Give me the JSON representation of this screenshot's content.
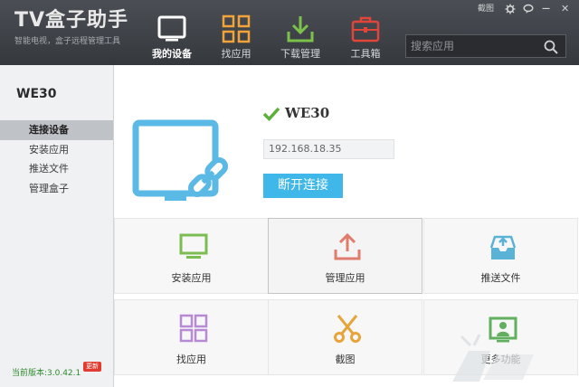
{
  "app": {
    "title": "TV盒子助手",
    "subtitle": "智能电视，盒子远程管理工具"
  },
  "nav": [
    {
      "label": "我的设备",
      "icon": "tv-icon",
      "active": true
    },
    {
      "label": "找应用",
      "icon": "grid-icon",
      "active": false
    },
    {
      "label": "下载管理",
      "icon": "download-icon",
      "active": false
    },
    {
      "label": "工具箱",
      "icon": "toolbox-icon",
      "active": false
    }
  ],
  "window_controls": {
    "screenshot": "截图",
    "settings_icon": "gear-icon",
    "feedback_icon": "chat-icon",
    "minimize": "—",
    "close": "✕"
  },
  "search": {
    "placeholder": "搜索应用",
    "icon": "search-icon"
  },
  "sidebar": {
    "device_name": "WE30",
    "items": [
      {
        "label": "连接设备",
        "active": true
      },
      {
        "label": "安装应用",
        "active": false
      },
      {
        "label": "推送文件",
        "active": false
      },
      {
        "label": "管理盒子",
        "active": false
      }
    ],
    "version": "当前版本:3.0.42.1",
    "update_badge": "更新"
  },
  "device": {
    "name": "WE30",
    "ip": "192.168.18.35",
    "disconnect_label": "断开连接"
  },
  "actions": [
    {
      "label": "安装应用",
      "icon": "monitor-icon",
      "color": "#7cbd53"
    },
    {
      "label": "管理应用",
      "icon": "upload-icon",
      "color": "#e07b6e"
    },
    {
      "label": "推送文件",
      "icon": "inbox-icon",
      "color": "#5ab2d6"
    },
    {
      "label": "找应用",
      "icon": "grid-icon",
      "color": "#b88ad6"
    },
    {
      "label": "截图",
      "icon": "scissors-icon",
      "color": "#e6a43a"
    },
    {
      "label": "更多功能",
      "icon": "tv-user-icon",
      "color": "#62b05f"
    }
  ],
  "colors": {
    "accent": "#3fb7e8",
    "header": "#3f4247",
    "check": "#5ab03a"
  }
}
